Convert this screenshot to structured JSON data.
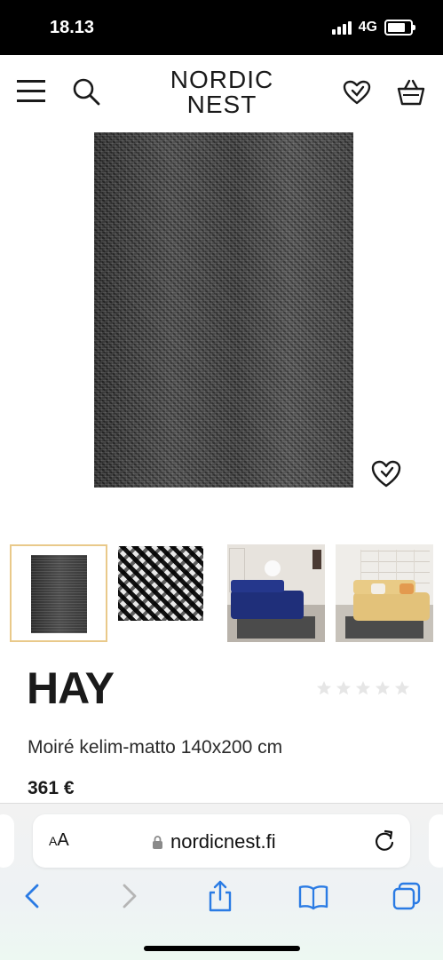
{
  "status_bar": {
    "time": "18.13",
    "network": "4G"
  },
  "header": {
    "logo_line1": "NORDIC",
    "logo_line2": "NEST"
  },
  "product": {
    "brand": "HAY",
    "name": "Moiré kelim-matto 140x200 cm",
    "price": "361 €",
    "rating": 0,
    "rating_max": 5
  },
  "browser": {
    "text_size_label_small": "A",
    "text_size_label_large": "A",
    "url": "nordicnest.fi"
  },
  "colors": {
    "thumb_selected_border": "#e9c98a",
    "star_empty": "#e6e6e6",
    "browser_accent": "#2a7be4"
  }
}
